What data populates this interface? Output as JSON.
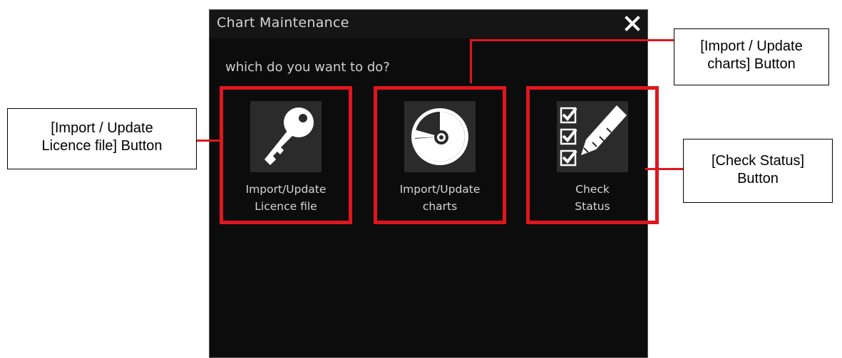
{
  "dialog": {
    "title": "Chart Maintenance",
    "close_glyph": "×",
    "prompt": "which do you want to do?"
  },
  "options": [
    {
      "line1": "Import/Update",
      "line2": "Licence file",
      "icon": "key-icon"
    },
    {
      "line1": "Import/Update",
      "line2": "charts",
      "icon": "disc-icon"
    },
    {
      "line1": "Check",
      "line2": "Status",
      "icon": "checklist-pencil-icon"
    }
  ],
  "callouts": {
    "licence": {
      "line1": "[Import / Update",
      "line2": "Licence file] Button"
    },
    "charts": {
      "line1": "[Import / Update",
      "line2": "charts] Button"
    },
    "status": {
      "line1": "[Check Status]",
      "line2": "Button"
    }
  },
  "colors": {
    "highlight": "#e0161e",
    "dialog_bg": "#0c0c0c",
    "icon_bg": "#2b2b2b",
    "text": "#d6d6d6"
  }
}
